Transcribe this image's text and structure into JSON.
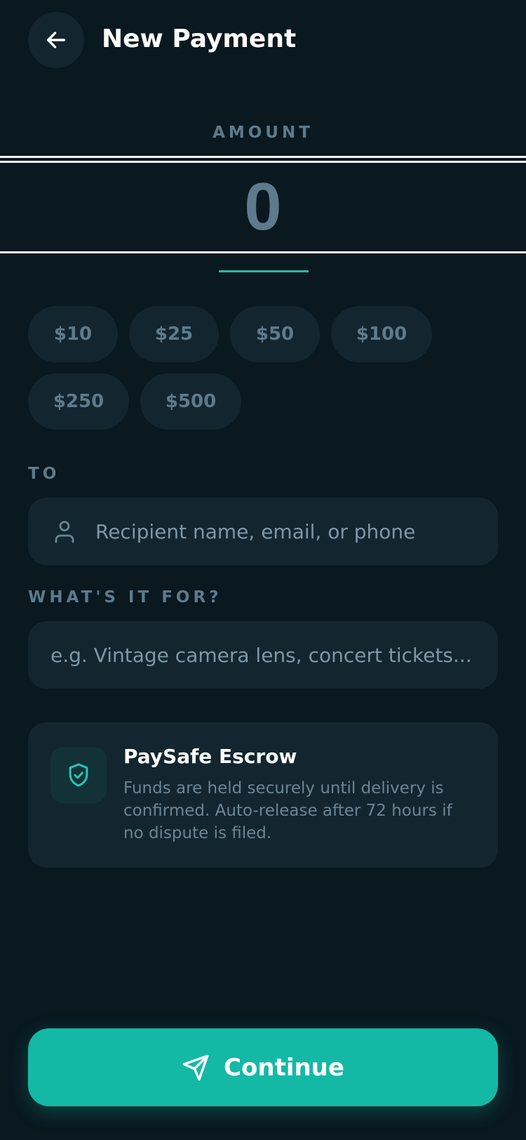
{
  "header": {
    "title": "New Payment",
    "back_icon": "arrow-left-icon"
  },
  "amount": {
    "label": "AMOUNT",
    "placeholder": "0"
  },
  "quick_amounts": [
    "$10",
    "$25",
    "$50",
    "$100",
    "$250",
    "$500"
  ],
  "recipient": {
    "label": "TO",
    "placeholder": "Recipient name, email, or phone",
    "icon": "person-icon"
  },
  "purpose": {
    "label": "WHAT'S IT FOR?",
    "placeholder": "e.g. Vintage camera lens, concert tickets..."
  },
  "escrow": {
    "title": "PaySafe Escrow",
    "description": "Funds are held securely until delivery is confirmed. Auto-release after 72 hours if no dispute is filed.",
    "icon": "shield-check-icon"
  },
  "continue_button": {
    "label": "Continue",
    "icon": "send-icon"
  },
  "colors": {
    "background": "#0a1820",
    "surface": "#13262f",
    "accent": "#13b9a5",
    "muted_text": "#5e7a8c"
  }
}
